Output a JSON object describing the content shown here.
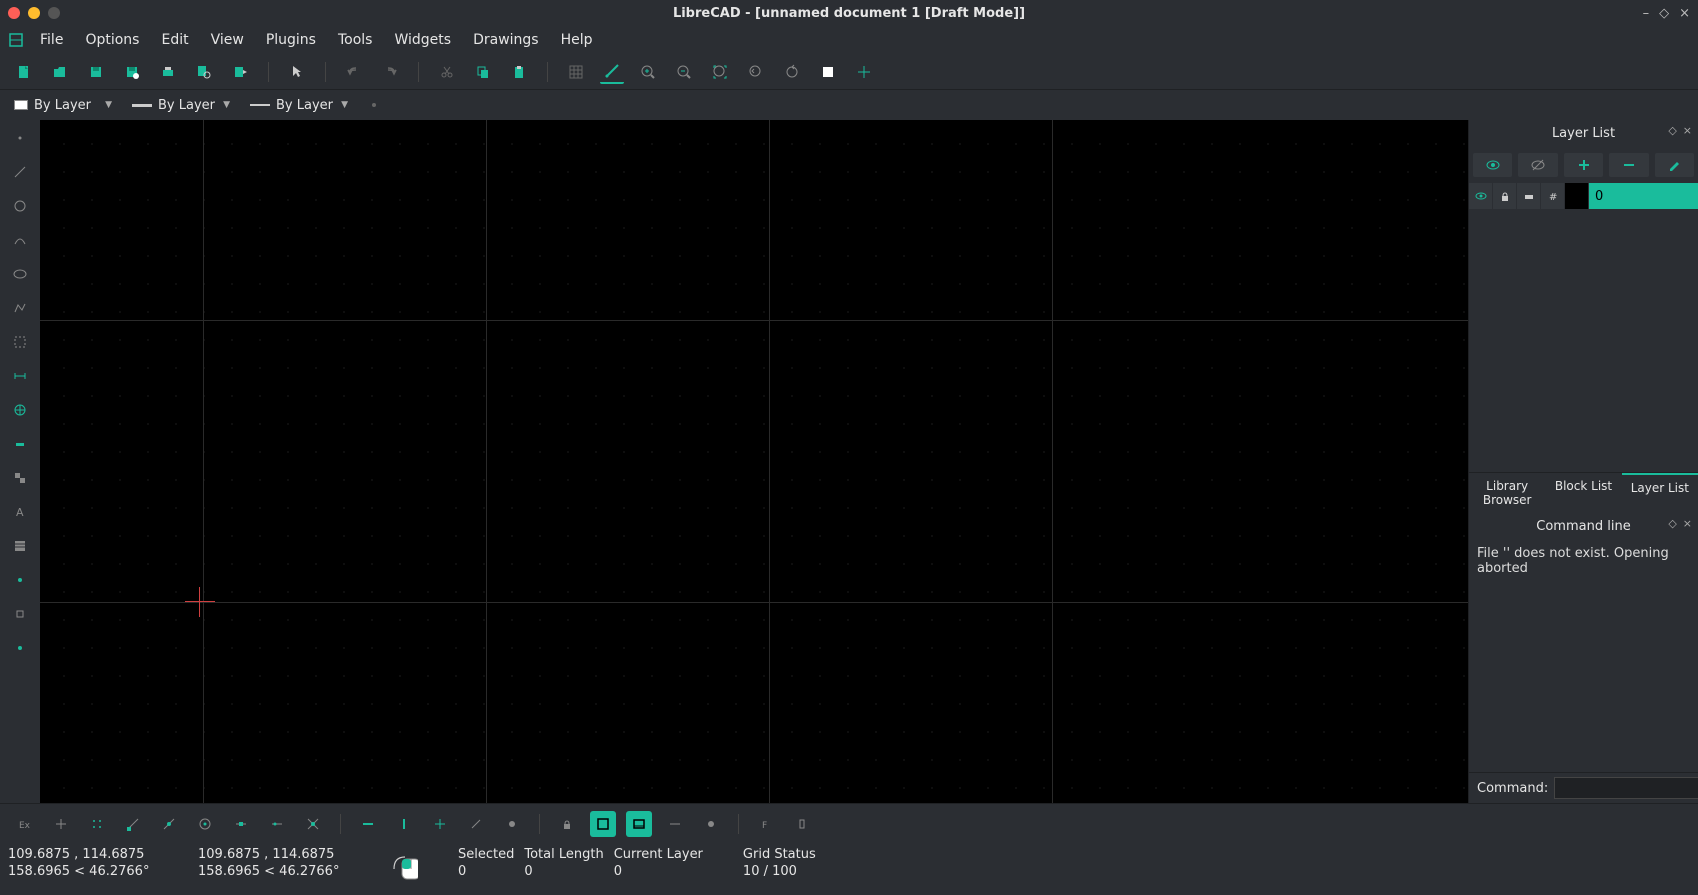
{
  "title": "LibreCAD - [unnamed document 1 [Draft Mode]]",
  "menu": [
    "File",
    "Options",
    "Edit",
    "View",
    "Plugins",
    "Tools",
    "Widgets",
    "Drawings",
    "Help"
  ],
  "combos": {
    "color": "By Layer",
    "width": "By Layer",
    "linetype": "By Layer"
  },
  "layer_panel": {
    "title": "Layer List",
    "row_name": "0",
    "tabs": [
      "Library Browser",
      "Block List",
      "Layer List"
    ]
  },
  "cmd_panel": {
    "title": "Command line",
    "output": "File '' does not exist. Opening aborted",
    "prompt": "Command:"
  },
  "status": {
    "coord_abs": "109.6875 , 114.6875",
    "coord_polar": "158.6965 < 46.2766°",
    "coord_abs2": "109.6875 , 114.6875",
    "coord_polar2": "158.6965 < 46.2766°",
    "selected_label": "Selected",
    "selected_val": "0",
    "total_label": "Total Length",
    "total_val": "0",
    "layer_label": "Current Layer",
    "layer_val": "0",
    "grid_label": "Grid Status",
    "grid_val": "10 / 100"
  }
}
